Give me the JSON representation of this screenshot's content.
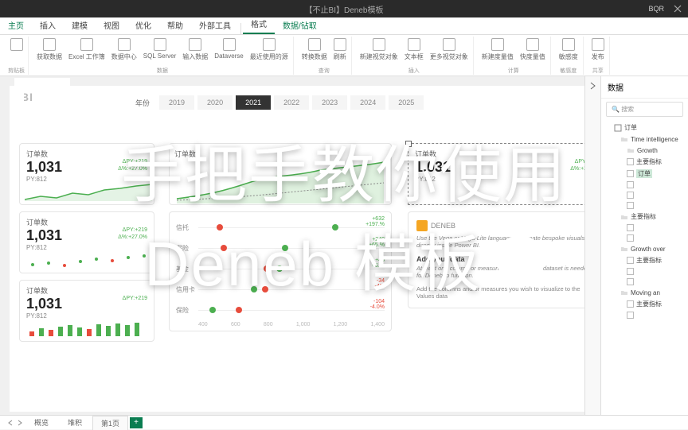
{
  "titlebar": {
    "title": "【不止BI】Deneb模板",
    "user": "BQR"
  },
  "ribbon_tabs": [
    "主页",
    "插入",
    "建模",
    "视图",
    "优化",
    "帮助",
    "外部工具",
    "格式",
    "数据/钻取"
  ],
  "ribbon_groups": {
    "g1": {
      "label": "数据",
      "btns": [
        "获取数据",
        "Excel 工作簿",
        "数据中心",
        "SQL Server",
        "输入数据",
        "Dataverse",
        "最近使用的源"
      ]
    },
    "g2": {
      "label": "查询",
      "btns": [
        "转换数据",
        "刷新"
      ]
    },
    "g3": {
      "label": "插入",
      "btns": [
        "新建视觉对象",
        "文本框",
        "更多视觉对象"
      ]
    },
    "g4": {
      "label": "计算",
      "btns": [
        "新建度量值",
        "快度量值"
      ]
    },
    "g5": {
      "label": "敏感度",
      "btns": [
        "敏感度"
      ]
    },
    "g6": {
      "label": "共享",
      "btns": [
        "发布"
      ]
    }
  },
  "logo": "BI",
  "year": {
    "label": "年份",
    "options": [
      "2019",
      "2020",
      "2021",
      "2022",
      "2023",
      "2024",
      "2025"
    ],
    "active": "2021"
  },
  "card": {
    "title": "订单数",
    "value": "1,031",
    "py_label": "PY:812",
    "dpy": "ΔPY:+219",
    "dpct": "Δ%:+27.0%"
  },
  "mid_title": "订单数",
  "dumbbell": {
    "rows": [
      {
        "label": "信托",
        "v1": "+632",
        "v2": "+197.%"
      },
      {
        "label": "保险",
        "v1": "+240",
        "v2": "+65.%"
      },
      {
        "label": "基金",
        "v1": "+45",
        "v2": "+6.%"
      },
      {
        "label": "信用卡",
        "v1": "-34",
        "v2": "-4%",
        "neg": true
      },
      {
        "label": "保险",
        "v1": "-104",
        "v2": "-4.0%",
        "neg": true
      }
    ],
    "axis": [
      "400",
      "600",
      "800",
      "1,000",
      "1,200",
      "1,400"
    ]
  },
  "deneb": {
    "brand": "DENEB",
    "desc": "Use the Vega or Vega-Lite languages to create bespoke visuals, directly inside Power BI.",
    "heading": "Add your data",
    "sub": "At least one column or measure in your visual's dataset is needed for Deneb to function.",
    "more": "Add the columns and/or measures you wish to visualize to the Values data"
  },
  "data_panel": {
    "title": "数据",
    "search": "搜索",
    "root": "订单",
    "nodes": [
      {
        "l": 1,
        "label": "Time intelligence"
      },
      {
        "l": 2,
        "label": "Growth"
      },
      {
        "l": 3,
        "label": "主要指标"
      },
      {
        "l": 3,
        "label": "订单"
      },
      {
        "l": 1,
        "label": "主要指标"
      },
      {
        "l": 1,
        "label": "Growth over"
      },
      {
        "l": 2,
        "label": "主要指标"
      },
      {
        "l": 1,
        "label": "Moving an"
      },
      {
        "l": 2,
        "label": "主要指标"
      }
    ]
  },
  "pages": {
    "tabs": [
      "概览",
      "堆积",
      "第1页"
    ],
    "active": "第1页",
    "add": "+"
  },
  "overlay": {
    "line1": "手把手教你使用",
    "line2": "Deneb 模板"
  },
  "chart_data": {
    "type": "bar",
    "title": "订单数",
    "value": 1031,
    "py": 812,
    "delta": 219,
    "delta_pct": 27.0,
    "years": [
      2019,
      2020,
      2021,
      2022,
      2023,
      2024,
      2025
    ],
    "selected_year": 2021
  }
}
